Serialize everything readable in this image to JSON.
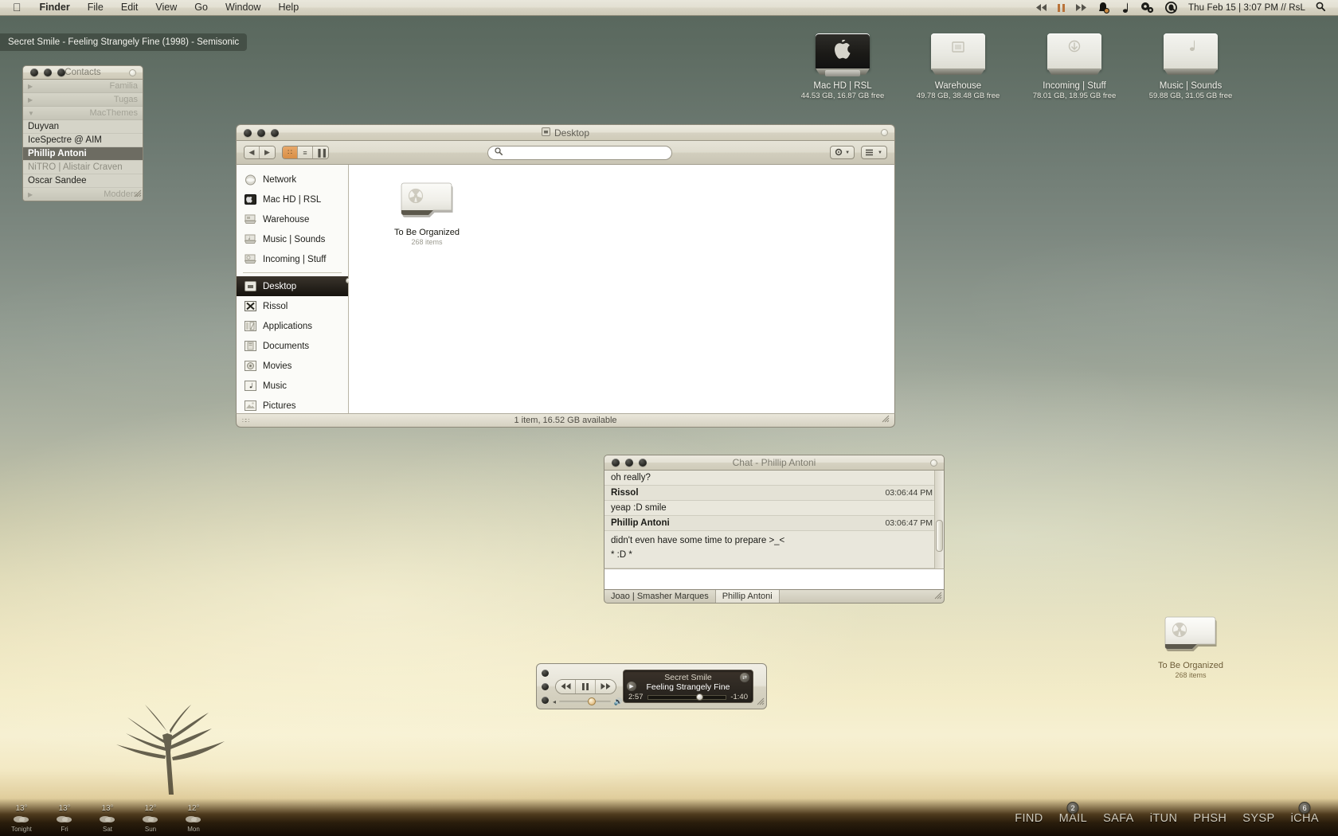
{
  "menubar": {
    "apple_icon": "apple-icon",
    "items": [
      "Finder",
      "File",
      "Edit",
      "View",
      "Go",
      "Window",
      "Help"
    ],
    "status_icons": [
      "rewind-icon",
      "pause-icon",
      "fastforward-icon",
      "itunes-notifier-icon",
      "music-note-icon",
      "gears-icon",
      "quicksilver-icon"
    ],
    "clock": "Thu Feb 15 | 3:07 PM // RsL",
    "spotlight_icon": "search-icon"
  },
  "track_notify": {
    "text": "Secret Smile - Feeling Strangely Fine (1998) - Semisonic"
  },
  "drives": [
    {
      "name": "Mac HD | RSL",
      "info": "44.53 GB, 16.87 GB free",
      "icon": "hard-drive-icon"
    },
    {
      "name": "Warehouse",
      "info": "49.78 GB, 38.48 GB free",
      "icon": "external-drive-icon"
    },
    {
      "name": "Incoming | Stuff",
      "info": "78.01 GB, 18.95 GB free",
      "icon": "external-drive-icon"
    },
    {
      "name": "Music | Sounds",
      "info": "59.88 GB, 31.05 GB free",
      "icon": "music-drive-icon"
    }
  ],
  "contacts": {
    "title": "Contacts",
    "groups": [
      {
        "label": "Familia",
        "expanded": false
      },
      {
        "label": "Tugas",
        "expanded": false
      },
      {
        "label": "MacThemes",
        "expanded": true
      },
      {
        "label": "Modders",
        "expanded": false
      }
    ],
    "buddies": [
      {
        "name": "Duyvan",
        "state": "online"
      },
      {
        "name": "IceSpectre @ AIM",
        "state": "online"
      },
      {
        "name": "Phillip Antoni",
        "state": "selected"
      },
      {
        "name": "NiTRO | Alistair Craven",
        "state": "away"
      },
      {
        "name": "Oscar Sandee",
        "state": "online"
      }
    ]
  },
  "finder": {
    "title": "Desktop",
    "title_icon": "desktop-icon",
    "nav_back": "◀",
    "nav_forward": "▶",
    "view_modes": [
      {
        "name": "icon-view",
        "glyph": "∷",
        "active": true
      },
      {
        "name": "list-view",
        "glyph": "≡",
        "active": false
      },
      {
        "name": "column-view",
        "glyph": "▐▐",
        "active": false
      }
    ],
    "search_placeholder": "",
    "action_button": "gear-icon",
    "arrange_button": "view-options-icon",
    "sidebar": [
      {
        "label": "Network",
        "icon": "network-globe-icon",
        "selected": false
      },
      {
        "label": "Mac HD | RSL",
        "icon": "hard-drive-icon",
        "selected": false
      },
      {
        "label": "Warehouse",
        "icon": "external-drive-icon",
        "selected": false
      },
      {
        "label": "Music | Sounds",
        "icon": "music-drive-icon",
        "selected": false
      },
      {
        "label": "Incoming | Stuff",
        "icon": "external-drive-icon",
        "selected": false
      },
      {
        "label": "Desktop",
        "icon": "desktop-icon",
        "selected": true
      },
      {
        "label": "Rissol",
        "icon": "home-user-icon",
        "selected": false
      },
      {
        "label": "Applications",
        "icon": "applications-icon",
        "selected": false
      },
      {
        "label": "Documents",
        "icon": "documents-icon",
        "selected": false
      },
      {
        "label": "Movies",
        "icon": "movies-icon",
        "selected": false
      },
      {
        "label": "Music",
        "icon": "music-icon",
        "selected": false
      },
      {
        "label": "Pictures",
        "icon": "pictures-icon",
        "selected": false
      }
    ],
    "files": [
      {
        "name": "To Be Organized",
        "sub": "268 items",
        "icon": "radiation-folder-icon"
      }
    ],
    "status": "1 item, 16.52 GB available"
  },
  "chat": {
    "title": "Chat - Phillip Antoni",
    "messages": [
      {
        "type": "text",
        "body": "oh really?"
      },
      {
        "type": "header",
        "sender": "Rissol",
        "time": "03:06:44 PM"
      },
      {
        "type": "text",
        "body": "yeap :D smile"
      },
      {
        "type": "header",
        "sender": "Phillip Antoni",
        "time": "03:06:47 PM"
      },
      {
        "type": "text",
        "body": "didn't even have some time to prepare >_<"
      },
      {
        "type": "text",
        "body": "* :D *"
      }
    ],
    "input_value": "",
    "tabs": [
      {
        "label": "Joao | Smasher Marques",
        "active": false
      },
      {
        "label": "Phillip Antoni",
        "active": true
      }
    ]
  },
  "itunes": {
    "controls": [
      "previous-icon",
      "pause-icon",
      "next-icon"
    ],
    "lcd": {
      "line1": "Secret Smile",
      "line2": "Feeling Strangely Fine",
      "elapsed": "2:57",
      "remaining": "-1:40"
    },
    "volume_icon": "speaker-icon",
    "source_icon": "play-source-icon",
    "shuffle_icon": "shuffle-icon"
  },
  "desktop_folder": {
    "name": "To Be Organized",
    "sub": "268 items",
    "icon": "radiation-folder-icon"
  },
  "dock": {
    "items": [
      {
        "label": "FIND",
        "badge": null
      },
      {
        "label": "MAIL",
        "badge": "2"
      },
      {
        "label": "SAFA",
        "badge": null
      },
      {
        "label": "iTUN",
        "badge": null
      },
      {
        "label": "PHSH",
        "badge": null
      },
      {
        "label": "SYSP",
        "badge": null
      },
      {
        "label": "iCHA",
        "badge": "6"
      }
    ]
  },
  "weather": [
    {
      "temp": "13°",
      "day": "Tonight"
    },
    {
      "temp": "13°",
      "day": "Fri"
    },
    {
      "temp": "13°",
      "day": "Sat"
    },
    {
      "temp": "12°",
      "day": "Sun"
    },
    {
      "temp": "12°",
      "day": "Mon"
    }
  ],
  "colors": {
    "accent_orange": "#d98e45",
    "selection_dark": "#16130e",
    "menubar_bg": "#e3e0d3"
  }
}
